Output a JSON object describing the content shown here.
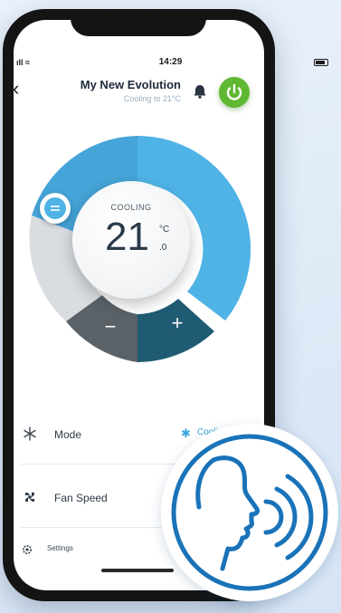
{
  "status_bar": {
    "time": "14:29",
    "signal_text": "ıll ≈"
  },
  "header": {
    "back_label": "‹",
    "device_name": "My New Evolution",
    "device_status": "Cooling to 21°C"
  },
  "icons": {
    "bell": "bell-icon",
    "power": "power-icon",
    "mode": "snowflake-icon",
    "fan": "fan-icon",
    "settings": "gear-icon",
    "equal": "equal-icon",
    "voice": "voice-speaking-icon"
  },
  "thermostat": {
    "mode": "COOLING",
    "temperature": "21",
    "unit": "°C",
    "decimal": ".0",
    "minus_label": "−",
    "plus_label": "+"
  },
  "list": {
    "mode_label": "Mode",
    "mode_value": "Cooling",
    "mode_value_icon": "✱",
    "fan_label": "Fan Speed",
    "settings_label": "Settings"
  },
  "colors": {
    "cooling_blue": "#4fb3e6",
    "power_green": "#5fb832",
    "dial_grey": "#d9dde1",
    "minus_bg": "#5a6268",
    "plus_bg": "#1f5b73",
    "voice_blue": "#1a73b8"
  }
}
